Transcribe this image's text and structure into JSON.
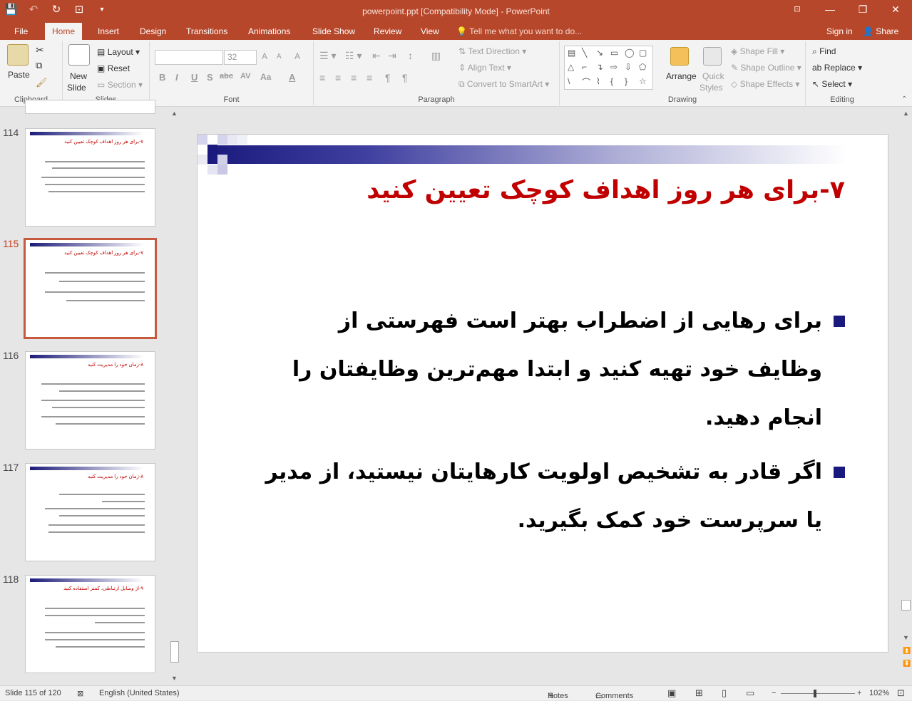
{
  "window": {
    "title": "powerpoint.ppt [Compatibility Mode] - PowerPoint",
    "minimize": "—",
    "restore": "❐",
    "close": "✕"
  },
  "qat": {
    "save": "💾",
    "undo": "↶",
    "repeat": "↻",
    "present": "⊡",
    "more": "▾"
  },
  "tabs": [
    "File",
    "Home",
    "Insert",
    "Design",
    "Transitions",
    "Animations",
    "Slide Show",
    "Review",
    "View"
  ],
  "active_tab": "Home",
  "tell_me": "Tell me what you want to do...",
  "account": {
    "sign_in": "Sign in",
    "share": "Share"
  },
  "ribbon": {
    "clipboard": {
      "label": "Clipboard",
      "paste": "Paste"
    },
    "slides": {
      "label": "Slides",
      "new_slide": "New",
      "new_slide2": "Slide",
      "layout": "Layout",
      "reset": "Reset",
      "section": "Section"
    },
    "font": {
      "label": "Font",
      "font_name": "",
      "font_size": "32",
      "bold": "B",
      "italic": "I",
      "underline": "U",
      "strike": "S",
      "shadow": "abc",
      "spacing": "AV",
      "case": "Aa",
      "color": "A",
      "grow": "A",
      "shrink": "A",
      "clear": "A"
    },
    "paragraph": {
      "label": "Paragraph",
      "text_direction": "Text Direction",
      "align_text": "Align Text",
      "convert_smartart": "Convert to SmartArt"
    },
    "drawing": {
      "label": "Drawing",
      "arrange": "Arrange",
      "quick_styles": "Quick",
      "quick_styles2": "Styles",
      "shape_fill": "Shape Fill",
      "shape_outline": "Shape Outline",
      "shape_effects": "Shape Effects"
    },
    "editing": {
      "label": "Editing",
      "find": "Find",
      "replace": "Replace",
      "select": "Select"
    }
  },
  "thumbnails": [
    {
      "num": "114",
      "title": "۷-برای هر روز اهداف کوچک تعیین کنید"
    },
    {
      "num": "115",
      "title": "۷-برای هر روز اهداف کوچک تعیین کنید"
    },
    {
      "num": "116",
      "title": "۸-زمان خود را مدیریت کنید"
    },
    {
      "num": "117",
      "title": "۸-زمان خود را مدیریت کنید"
    },
    {
      "num": "118",
      "title": "۹-از وسایل ارتباطی، کمتر استفاده کنید"
    }
  ],
  "slide": {
    "title": "۷-برای هر روز اهداف کوچک تعیین کنید",
    "bullets": [
      "برای رهایی از اضطراب بهتر است فهرستی از وظایف خود تهیه کنید و ابتدا مهم‌ترین وظایفتان را انجام دهید.",
      "اگر قادر به تشخیص اولویت کارهایتان نیستید، از مدیر یا سرپرست خود کمک بگیرید."
    ]
  },
  "status": {
    "slide_info": "Slide 115 of 120",
    "language": "English (United States)",
    "notes": "Notes",
    "comments": "Comments",
    "zoom": "102%"
  }
}
